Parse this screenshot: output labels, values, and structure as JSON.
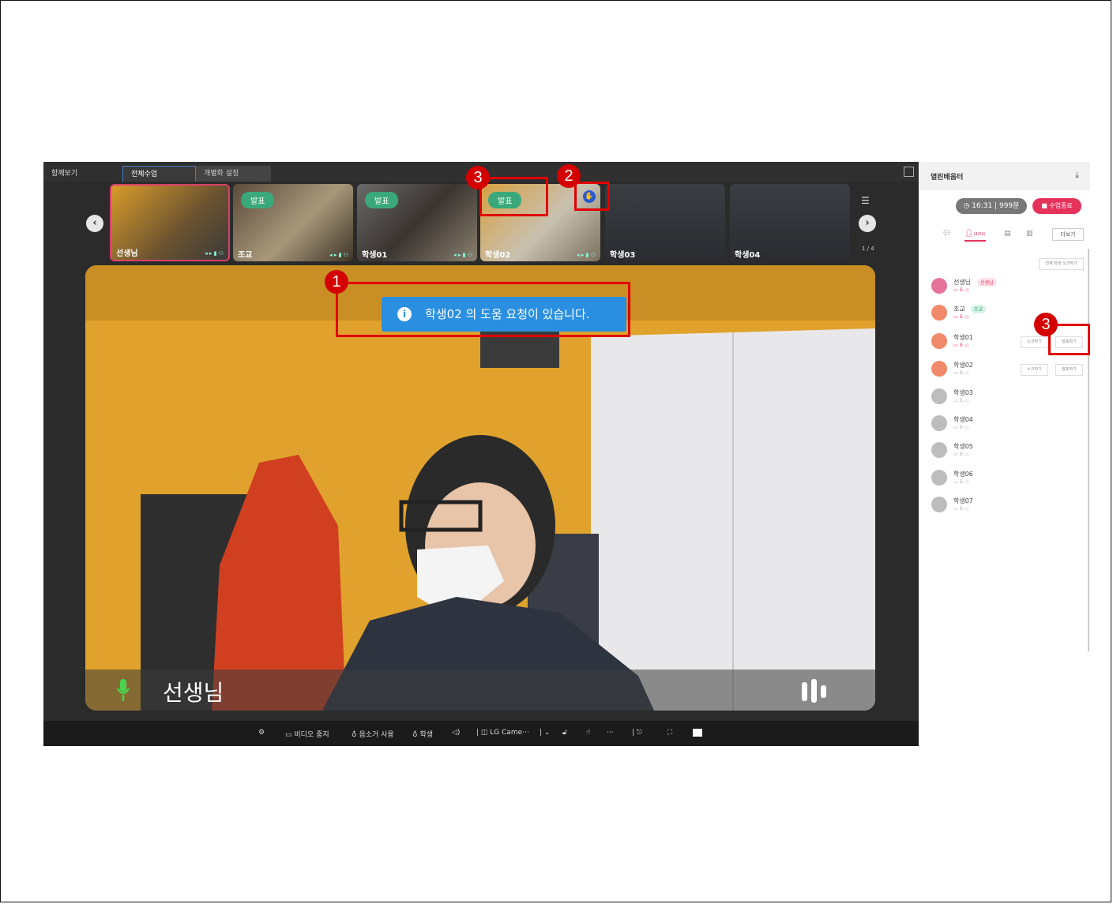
{
  "tabs": [
    "함께보기",
    "전체수업",
    "개별화 설정"
  ],
  "participants_strip": [
    {
      "name": "선생님",
      "badge": ""
    },
    {
      "name": "조교",
      "badge": "발표"
    },
    {
      "name": "학생01",
      "badge": "발표"
    },
    {
      "name": "학생02",
      "badge": "발표"
    },
    {
      "name": "학생03",
      "badge": ""
    },
    {
      "name": "학생04",
      "badge": ""
    }
  ],
  "page_indicator": "1 / 4",
  "notification": "학생02 의 도움 요청이 있습니다.",
  "speaker_name": "선생님",
  "toolbar": {
    "video_stop": "비디오 중지",
    "speaker_use": "음소거 사용",
    "student": "학생",
    "camera": "LG Came···"
  },
  "panel": {
    "title": "열린배움터",
    "timer": "16:31",
    "limit": "999분",
    "end_button": "수업종료",
    "participants_tab": "(4/24)",
    "more_button": "더보기",
    "mute_all": "전체 학생 노크하기",
    "users": [
      {
        "name": "선생님",
        "role": "선생님"
      },
      {
        "name": "조교",
        "role": "조교"
      },
      {
        "name": "학생01",
        "role": ""
      },
      {
        "name": "학생02",
        "role": ""
      },
      {
        "name": "학생03",
        "role": ""
      },
      {
        "name": "학생04",
        "role": ""
      },
      {
        "name": "학생05",
        "role": ""
      },
      {
        "name": "학생06",
        "role": ""
      },
      {
        "name": "학생07",
        "role": ""
      }
    ],
    "knock_label": "노크하기",
    "present_label": "발표하기"
  },
  "markers": [
    "1",
    "2",
    "3",
    "3"
  ],
  "colors": {
    "accent": "#e5325b",
    "info": "#2a8fe0",
    "present": "#3aa87a",
    "marker": "#d40000"
  }
}
